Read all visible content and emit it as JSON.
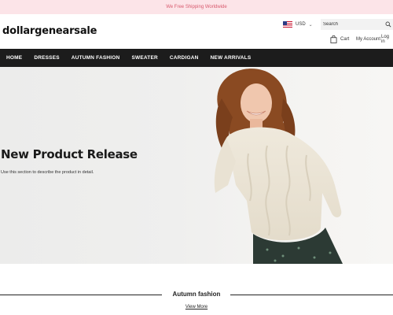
{
  "announcement": "We Free Shipping Worldwide",
  "header": {
    "logo": "dollargenearsale",
    "currency": "USD",
    "search_placeholder": "Search",
    "cart_label": "Cart",
    "account_label": "My Account",
    "login_label": "Log in"
  },
  "nav": {
    "items": [
      "HOME",
      "DRESSES",
      "AUTUMN FASHION",
      "SWEATER",
      "CARDIGAN",
      "NEW ARRIVALS"
    ]
  },
  "hero": {
    "title": "New Product Release",
    "subtitle": "Use this section to describe the product in detail."
  },
  "section": {
    "title": "Autumn fashion",
    "link": "View More"
  },
  "colors": {
    "announcement_bg": "#fce4e8",
    "announcement_text": "#d85a6e",
    "nav_bg": "#1c1c1c"
  }
}
